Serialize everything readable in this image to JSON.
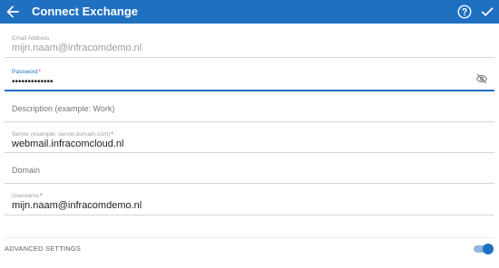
{
  "appbar": {
    "title": "Connect Exchange",
    "bg_color": "#1f70c1",
    "icons": [
      "back-arrow-icon",
      "help-icon",
      "check-icon"
    ]
  },
  "form": {
    "email": {
      "label": "Email Address",
      "value": "mijn.naam@infracomdemo.nl"
    },
    "password": {
      "label": "Password",
      "required_mark": "*",
      "value": "•••••••••••••",
      "icon": "visibility-off-icon"
    },
    "description": {
      "placeholder": "Description (example: Work)"
    },
    "server": {
      "label": "Server (example: server.domain.com)",
      "required_mark": "*",
      "value": "webmail.infracomcloud.nl"
    },
    "domain": {
      "placeholder": "Domain"
    },
    "username": {
      "label": "Username",
      "required_mark": "*",
      "value": "mijn.naam@infracomdemo.nl"
    }
  },
  "advanced": {
    "label": "ADVANCED SETTINGS",
    "enabled": true
  },
  "colors": {
    "accent": "#1f70c1",
    "required": "#d32f2f"
  }
}
